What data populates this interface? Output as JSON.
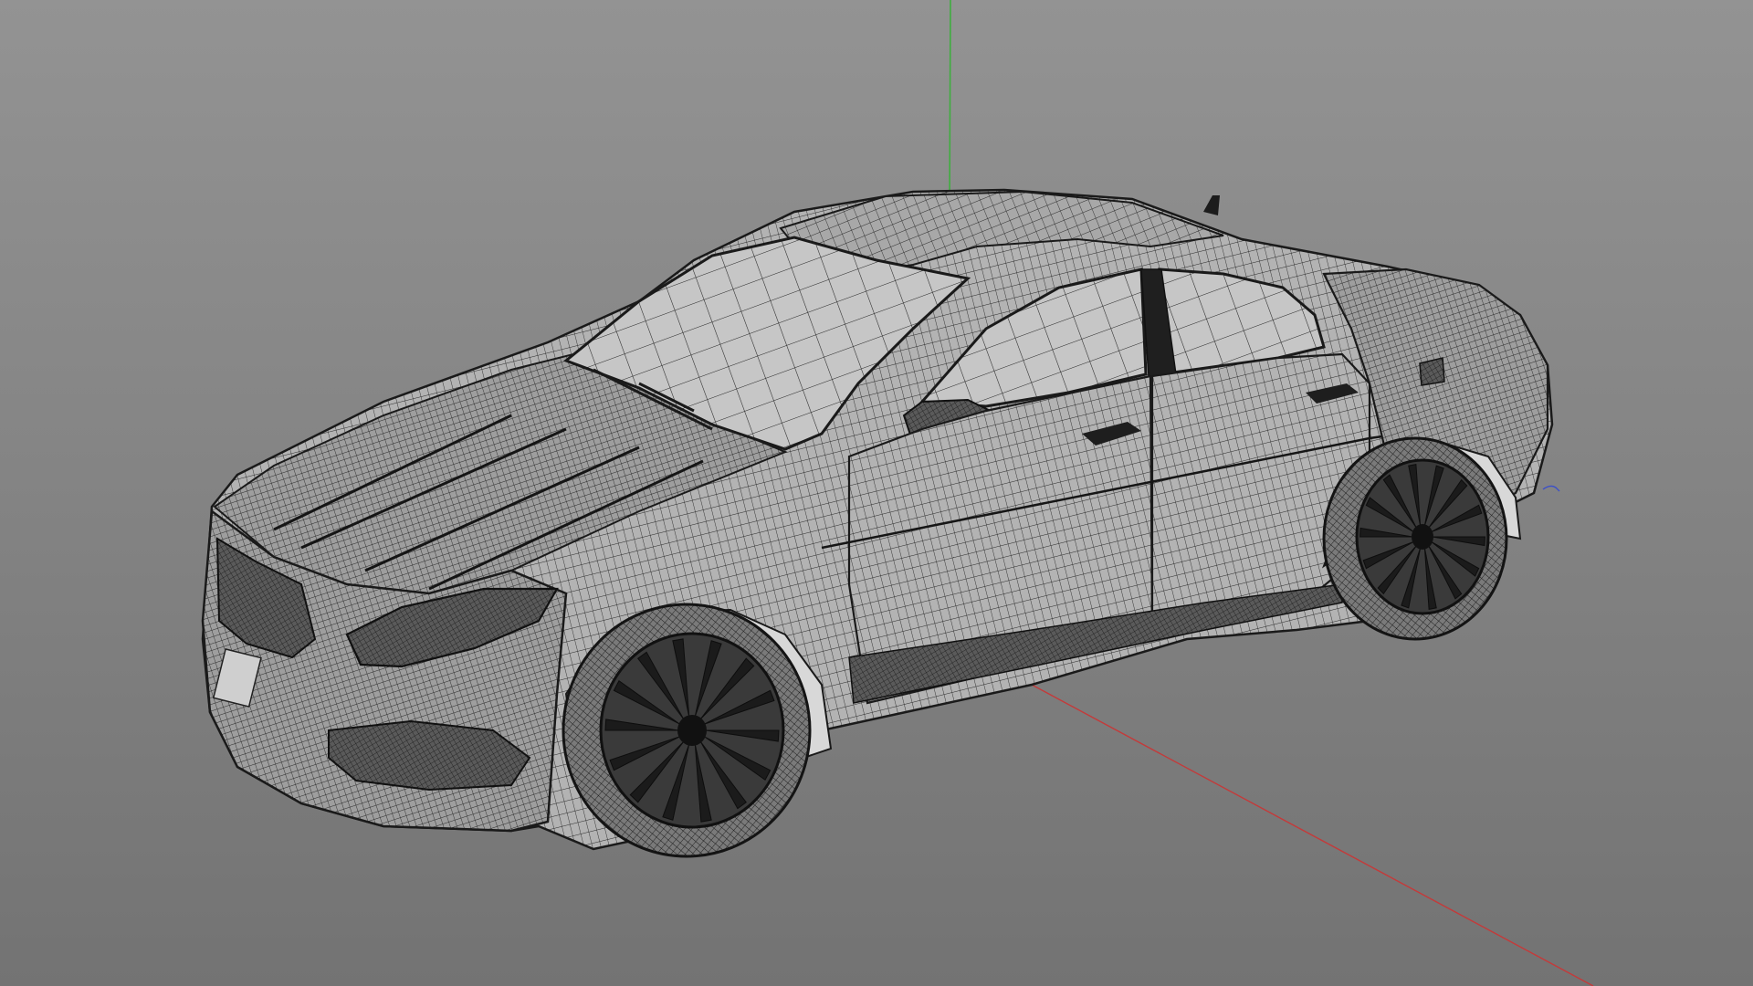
{
  "viewport": {
    "background_top": "#939393",
    "background_bottom": "#737373"
  },
  "axes": {
    "x_color": "#c43a3a",
    "y_color": "#3fae3f",
    "z_color": "#3b4fc8"
  },
  "model": {
    "display_mode": "wireframe",
    "wire_color": "#1f1f1f",
    "surface_color": "#bdbdbd",
    "glass_color": "#c9c9c9",
    "wheel_color": "#1b1b1b"
  }
}
